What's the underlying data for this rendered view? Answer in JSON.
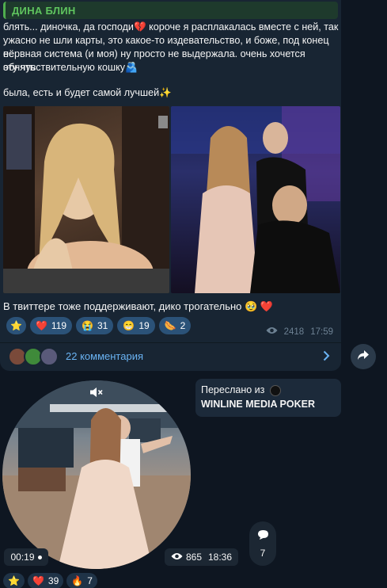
{
  "post": {
    "reply_author": "ДИНА БЛИН",
    "text_line1": "блять... диночка, да господи💔 короче я расплакалась вместе с ней, так",
    "text_line2": "ужасно не шли карты, это какое-то издевательство, и боже, под конец её",
    "text_line3": "нервная система (и моя) ну просто не выдержала. очень хочется обнять",
    "text_line4": "эту чувствительную кошку🫂",
    "text_line5": "была, есть и будет самой лучшей✨",
    "caption": "В твиттере тоже поддерживают, дико трогательно 🥹 ❤️",
    "reactions": [
      {
        "icon": "⭐",
        "count": ""
      },
      {
        "icon": "❤️",
        "count": "119"
      },
      {
        "icon": "😭",
        "count": "31"
      },
      {
        "icon": "😁",
        "count": "19"
      },
      {
        "icon": "🌭",
        "count": "2"
      }
    ],
    "views": "2418",
    "time": "17:59",
    "comments_label": "22 комментария"
  },
  "forwarded": {
    "prefix": "Переслано из",
    "channel": "WINLINE MEDIA POKER"
  },
  "video": {
    "duration": "00:19",
    "views": "865",
    "time": "18:36",
    "comments_count": "7",
    "reactions": [
      {
        "icon": "⭐",
        "count": ""
      },
      {
        "icon": "❤️",
        "count": "39"
      },
      {
        "icon": "🔥",
        "count": "7"
      }
    ]
  },
  "colors": {
    "background": "#0e1621",
    "bubble": "#182533",
    "accent_link": "#6ab3f3",
    "reply_green": "#5fc45e",
    "reaction_pill": "#2b5278"
  }
}
